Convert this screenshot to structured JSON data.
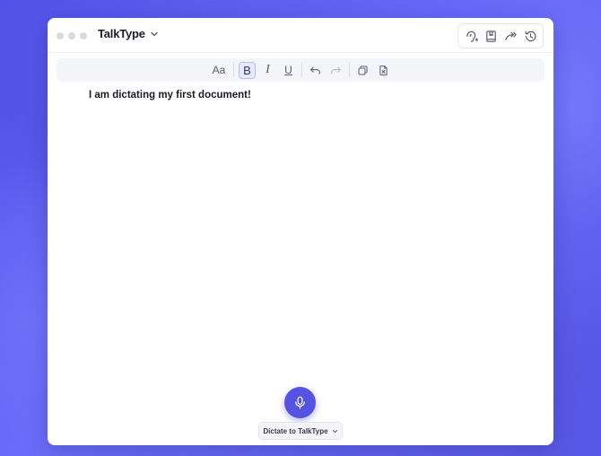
{
  "app": {
    "title": "TalkType"
  },
  "toolbar": {
    "font_label": "Aa",
    "bold_label": "B",
    "italic_label": "I",
    "underline_label": "U"
  },
  "editor": {
    "content": "I am dictating my first document!"
  },
  "dictation": {
    "target_label": "Dictate to TalkType"
  },
  "colors": {
    "accent": "#5653e3",
    "background": "#5d5cf0"
  },
  "icons": {
    "title_actions": [
      "listen-icon",
      "book-icon",
      "forward-icon",
      "history-icon"
    ],
    "toolbar": [
      "font-size-icon",
      "bold-icon",
      "italic-icon",
      "underline-icon",
      "undo-icon",
      "redo-icon",
      "copy-icon",
      "clear-document-icon"
    ]
  }
}
